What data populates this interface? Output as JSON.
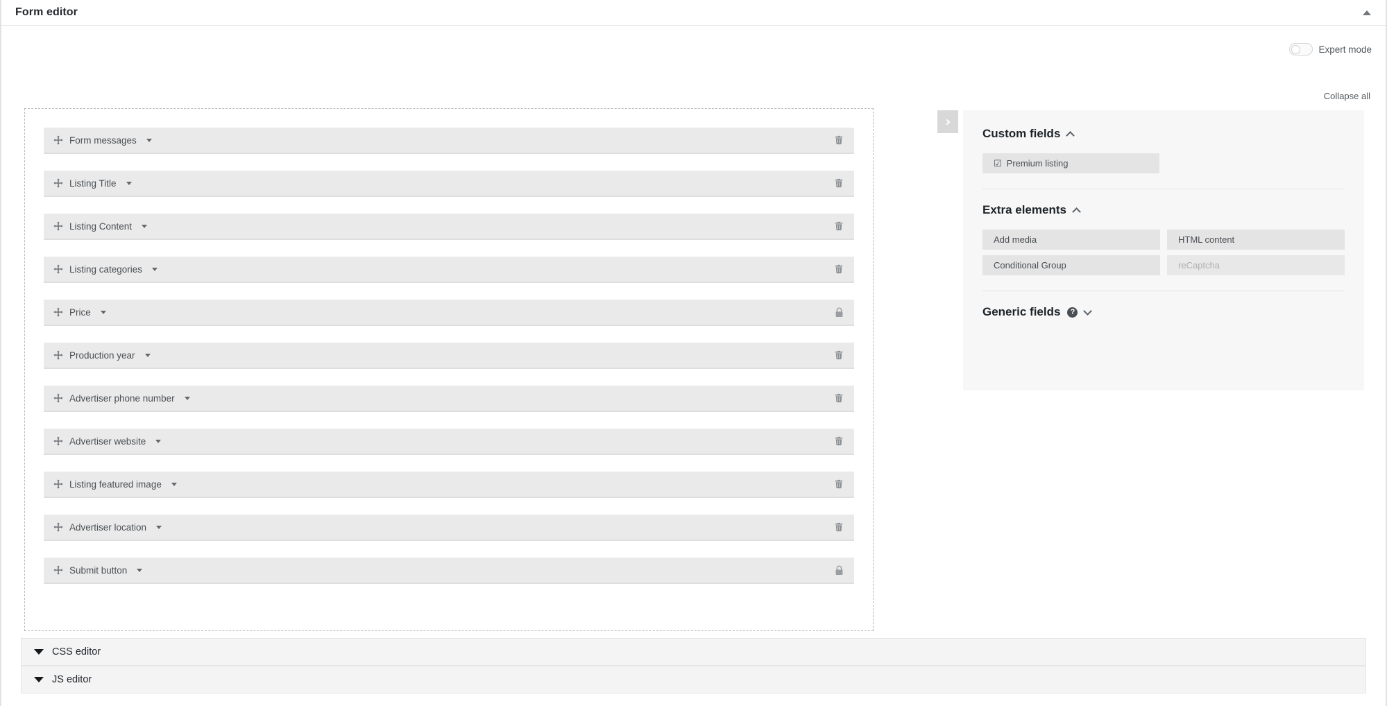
{
  "titlebar": {
    "title": "Form editor",
    "collapse_icon": "caret-up-icon"
  },
  "toolbar": {
    "expert_mode_label": "Expert mode",
    "expert_mode_on": false,
    "collapse_all_label": "Collapse all"
  },
  "sidebar_handle": {
    "icon": "chevron-right-icon"
  },
  "form_fields": [
    {
      "label": "Form messages",
      "action": "delete",
      "action_icon": "trash-icon"
    },
    {
      "label": "Listing Title",
      "action": "delete",
      "action_icon": "trash-icon"
    },
    {
      "label": "Listing Content",
      "action": "delete",
      "action_icon": "trash-icon"
    },
    {
      "label": "Listing categories",
      "action": "delete",
      "action_icon": "trash-icon"
    },
    {
      "label": "Price",
      "action": "locked",
      "action_icon": "lock-icon"
    },
    {
      "label": "Production year",
      "action": "delete",
      "action_icon": "trash-icon"
    },
    {
      "label": "Advertiser phone number",
      "action": "delete",
      "action_icon": "trash-icon"
    },
    {
      "label": "Advertiser website",
      "action": "delete",
      "action_icon": "trash-icon"
    },
    {
      "label": "Listing featured image",
      "action": "delete",
      "action_icon": "trash-icon"
    },
    {
      "label": "Advertiser location",
      "action": "delete",
      "action_icon": "trash-icon"
    },
    {
      "label": "Submit button",
      "action": "locked",
      "action_icon": "lock-icon"
    }
  ],
  "sidebar": {
    "custom_fields": {
      "title": "Custom fields",
      "expanded": true,
      "chevron": "chevron-up-icon",
      "items": [
        {
          "label": "Premium listing",
          "icon": "checkbox-checked-icon",
          "disabled": false
        }
      ]
    },
    "extra_elements": {
      "title": "Extra elements",
      "expanded": true,
      "chevron": "chevron-up-icon",
      "items": [
        {
          "label": "Add media",
          "disabled": false
        },
        {
          "label": "HTML content",
          "disabled": false
        },
        {
          "label": "Conditional Group",
          "disabled": false
        },
        {
          "label": "reCaptcha",
          "disabled": true
        }
      ]
    },
    "generic_fields": {
      "title": "Generic fields",
      "expanded": false,
      "help_icon": "help-icon",
      "help_glyph": "?",
      "chevron": "chevron-down-icon"
    }
  },
  "bottom_editors": [
    {
      "label": "CSS editor",
      "expanded": false,
      "icon": "caret-down-icon"
    },
    {
      "label": "JS editor",
      "expanded": false,
      "icon": "caret-down-icon"
    }
  ],
  "colors": {
    "page_bg": "#ffffff",
    "field_row": "#eaeaea",
    "sidebar_bg": "#f7f7f8",
    "chip_bg": "#e4e4e4",
    "text": "#4a4f54",
    "heading": "#1d2327",
    "editor_bar": "#f4f4f5"
  }
}
